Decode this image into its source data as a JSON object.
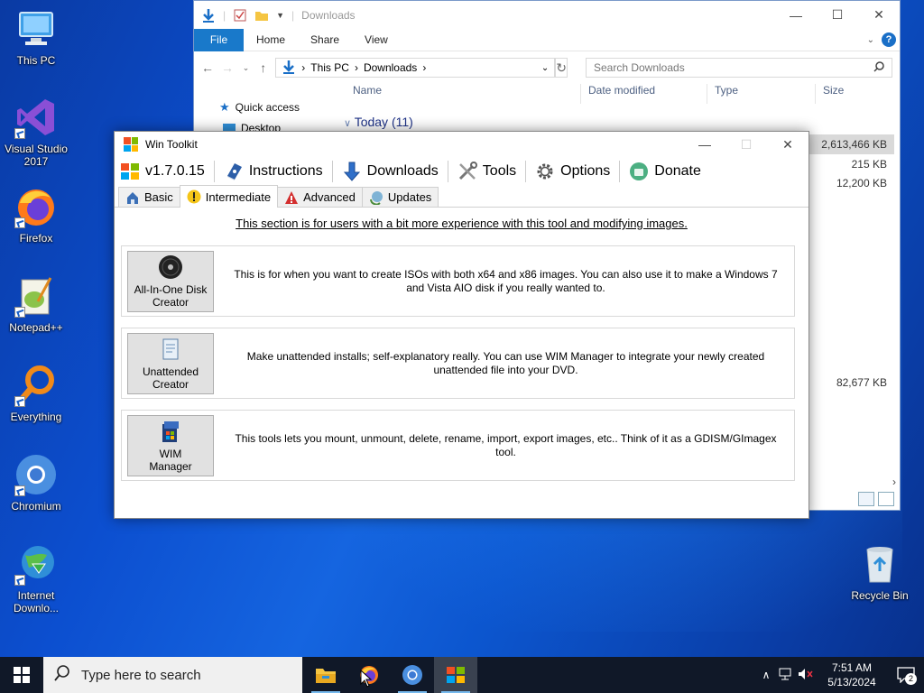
{
  "desktop": {
    "icons": [
      {
        "label": "This PC"
      },
      {
        "label": "Visual Studio 2017"
      },
      {
        "label": "Firefox"
      },
      {
        "label": "Notepad++"
      },
      {
        "label": "Everything"
      },
      {
        "label": "Chromium"
      },
      {
        "label": "Internet Downlo..."
      },
      {
        "label": "Recycle Bin"
      }
    ]
  },
  "explorer": {
    "title": "Downloads",
    "ribbon_tabs": {
      "file": "File",
      "home": "Home",
      "share": "Share",
      "view": "View"
    },
    "address": {
      "root": "This PC",
      "folder": "Downloads"
    },
    "search_placeholder": "Search Downloads",
    "columns": {
      "name": "Name",
      "date": "Date modified",
      "type": "Type",
      "size": "Size"
    },
    "nav": {
      "quick_access": "Quick access",
      "desktop": "Desktop"
    },
    "group": "Today (11)",
    "sizes": [
      "2,613,466 KB",
      "215 KB",
      "12,200 KB",
      "82,677 KB"
    ]
  },
  "wintoolkit": {
    "title": "Win Toolkit",
    "menu": {
      "version": "v1.7.0.15",
      "instructions": "Instructions",
      "downloads": "Downloads",
      "tools": "Tools",
      "options": "Options",
      "donate": "Donate"
    },
    "tabs": {
      "basic": "Basic",
      "intermediate": "Intermediate",
      "advanced": "Advanced",
      "updates": "Updates"
    },
    "intro": "This section is for users with a bit more experience with this tool and modifying images.",
    "cards": [
      {
        "button_line1": "All-In-One Disk",
        "button_line2": "Creator",
        "description": "This is for when you want to create ISOs with both x64 and x86 images. You can also use it to make a Windows 7 and Vista AIO disk if you really wanted to."
      },
      {
        "button_line1": "Unattended",
        "button_line2": "Creator",
        "description": "Make unattended installs; self-explanatory really. You can use WIM Manager to integrate your newly created unattended file into your DVD."
      },
      {
        "button_line1": "WIM",
        "button_line2": "Manager",
        "description": "This tools lets you mount, unmount, delete, rename, import, export images, etc.. Think of it as a GDISM/GImagex tool."
      }
    ]
  },
  "taskbar": {
    "search_placeholder": "Type here to search",
    "time": "7:51 AM",
    "date": "5/13/2024",
    "notification_count": "2"
  },
  "colors": {
    "accent": "#1979ca",
    "taskbar": "#101828",
    "desktop": "#0c4fd0"
  }
}
